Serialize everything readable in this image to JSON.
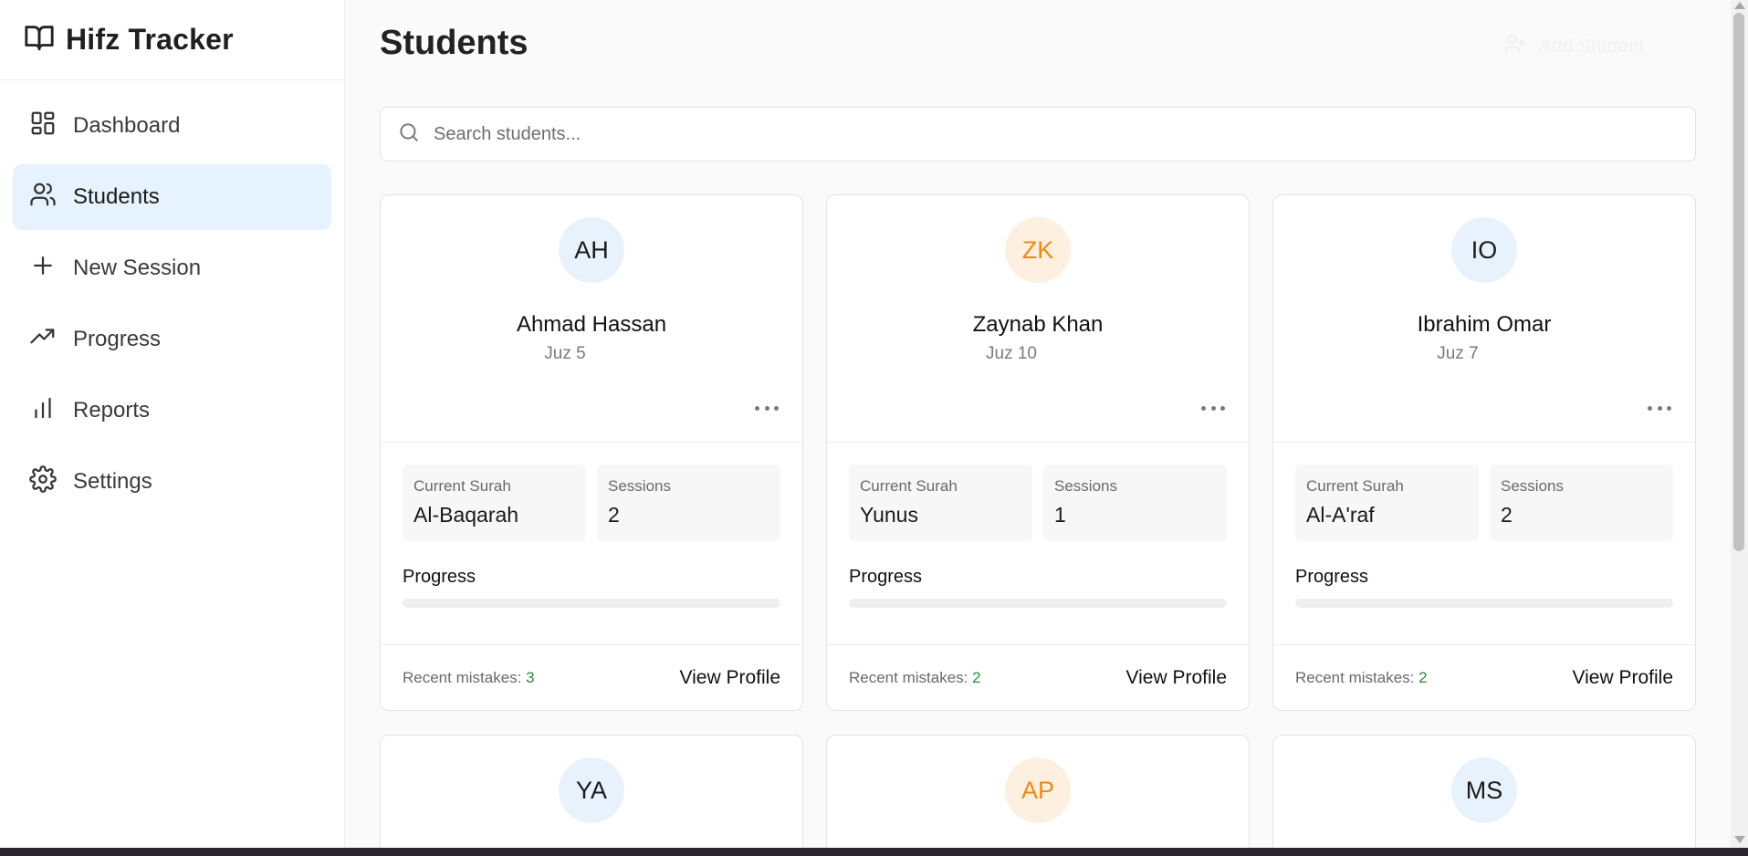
{
  "app": {
    "title": "Hifz Tracker"
  },
  "sidebar": {
    "items": [
      {
        "label": "Dashboard",
        "icon": "dashboard-icon",
        "active": false
      },
      {
        "label": "Students",
        "icon": "users-icon",
        "active": true
      },
      {
        "label": "New Session",
        "icon": "plus-icon",
        "active": false
      },
      {
        "label": "Progress",
        "icon": "trending-up-icon",
        "active": false
      },
      {
        "label": "Reports",
        "icon": "bar-chart-icon",
        "active": false
      },
      {
        "label": "Settings",
        "icon": "gear-icon",
        "active": false
      }
    ]
  },
  "header": {
    "title": "Students",
    "add_label": "Add Student"
  },
  "search": {
    "placeholder": "Search students...",
    "value": ""
  },
  "labels": {
    "current_surah": "Current Surah",
    "sessions": "Sessions",
    "progress": "Progress",
    "recent_mistakes": "Recent mistakes:",
    "view_profile": "View Profile"
  },
  "students": [
    {
      "initials": "AH",
      "name": "Ahmad Hassan",
      "juz": "Juz 5",
      "surah": "Al-Baqarah",
      "sessions": "2",
      "mistakes": "3",
      "progress": 0,
      "avatar_color": "blue"
    },
    {
      "initials": "ZK",
      "name": "Zaynab Khan",
      "juz": "Juz 10",
      "surah": "Yunus",
      "sessions": "1",
      "mistakes": "2",
      "progress": 0,
      "avatar_color": "orange"
    },
    {
      "initials": "IO",
      "name": "Ibrahim Omar",
      "juz": "Juz 7",
      "surah": "Al-A'raf",
      "sessions": "2",
      "mistakes": "2",
      "progress": 0,
      "avatar_color": "blue"
    },
    {
      "initials": "YA",
      "avatar_color": "blue"
    },
    {
      "initials": "AP",
      "avatar_color": "orange"
    },
    {
      "initials": "MS",
      "avatar_color": "blue"
    }
  ],
  "colors": {
    "accent": "#e6f2fd",
    "mistakes": "#2e8b3a",
    "orange": "#f08a10"
  }
}
